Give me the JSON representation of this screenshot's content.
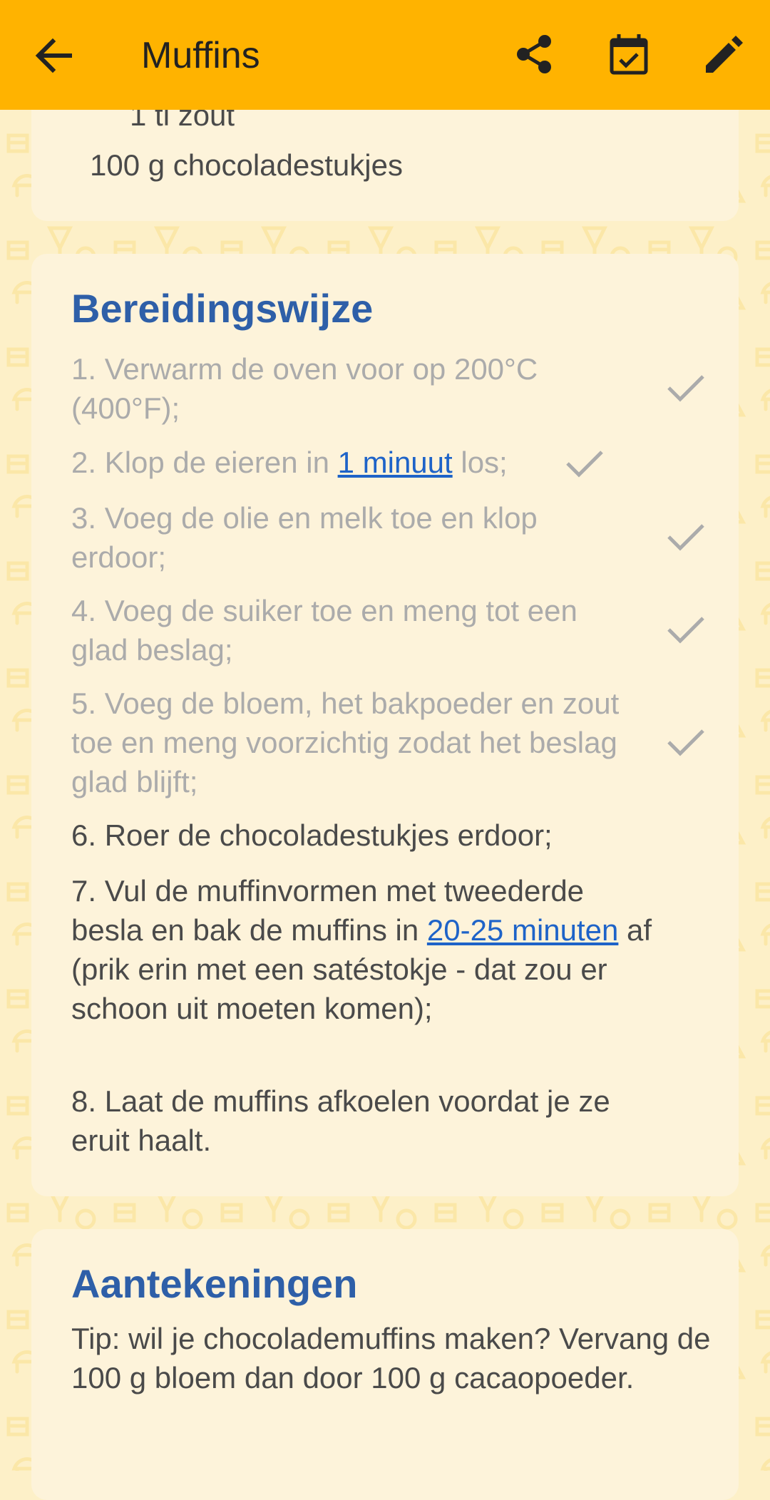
{
  "appbar": {
    "title": "Muffins",
    "icons": [
      "arrow-back-icon",
      "share-icon",
      "calendar-check-icon",
      "edit-pencil-icon"
    ]
  },
  "ingredients": {
    "lines": [
      "1 tl zout",
      "100 g chocoladestukjes"
    ]
  },
  "preparation": {
    "title": "Bereidingswijze",
    "steps": [
      {
        "text": "1. Verwarm de oven voor op 200°C (400°F);",
        "done": true
      },
      {
        "before": "2. Klop de eieren in ",
        "link": "1 minuut",
        "after": " los;",
        "done": true
      },
      {
        "text": "3. Voeg de olie en melk toe en klop erdoor;",
        "done": true
      },
      {
        "text": "4. Voeg de suiker toe en meng tot een glad beslag;",
        "done": true
      },
      {
        "text": "5. Voeg de bloem, het bakpoeder en zout toe en meng voorzichtig zodat het beslag glad blijft;",
        "done": true
      },
      {
        "text": "6. Roer de chocoladestukjes erdoor;",
        "done": false
      },
      {
        "before": "7. Vul de muffinvormen met tweederde besla en bak de muffins in ",
        "link": "20-25 minuten",
        "after": " af (prik erin met een satéstokje - dat zou er schoon uit moeten komen);",
        "done": false
      },
      {
        "text": "8. Laat de muffins afkoelen voordat je ze eruit haalt.",
        "done": false
      }
    ]
  },
  "notes": {
    "title": "Aantekeningen",
    "text": "Tip: wil je chocolademuffins maken? Vervang de 100 g bloem dan door 100 g cacaopoeder."
  },
  "colors": {
    "appbar": "#FFB300",
    "background": "#FDF0C8",
    "card": "#FDF3DA",
    "heading": "#2E5FA8",
    "link": "#1E63C8",
    "done_text": "#ABABAB"
  }
}
